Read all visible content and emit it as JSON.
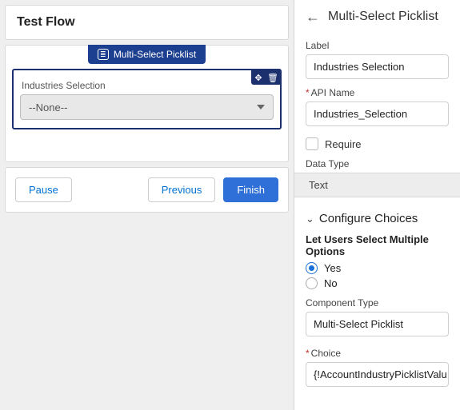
{
  "left": {
    "title": "Test Flow",
    "pill_label": "Multi-Select Picklist",
    "field_label": "Industries Selection",
    "combo_value": "--None--",
    "buttons": {
      "pause": "Pause",
      "previous": "Previous",
      "finish": "Finish"
    }
  },
  "right": {
    "title": "Multi-Select Picklist",
    "label_field": {
      "label": "Label",
      "value": "Industries Selection"
    },
    "api_field": {
      "label": "API Name",
      "value": "Industries_Selection"
    },
    "require_label": "Require",
    "data_type_label": "Data Type",
    "data_type_value": "Text",
    "section_label": "Configure Choices",
    "multi_label": "Let Users Select Multiple Options",
    "yes_label": "Yes",
    "no_label": "No",
    "component_type_label": "Component Type",
    "component_type_value": "Multi-Select Picklist",
    "choice_label": "Choice",
    "choice_value": "{!AccountIndustryPicklistValu"
  }
}
